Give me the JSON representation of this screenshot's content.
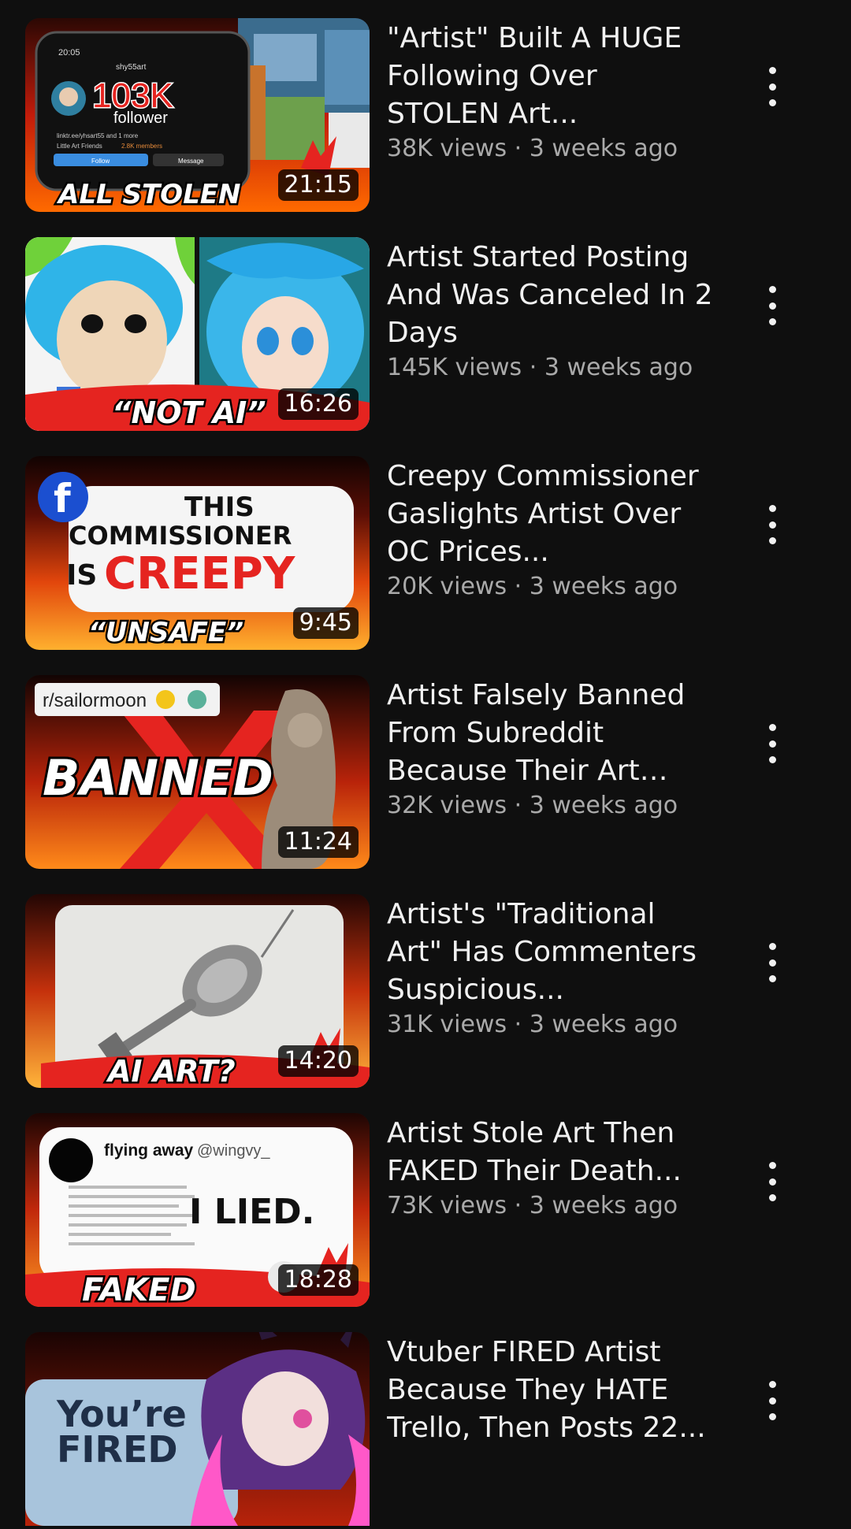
{
  "videos": [
    {
      "title": "\"Artist\" Built A HUGE Following Over STOLEN Art...",
      "views": "38K views",
      "separator": "·",
      "age": "3 weeks ago",
      "duration": "21:15",
      "thumb": {
        "icon": "phone-profile-thumbnail",
        "overlay": "ALL STOLEN",
        "profile_name": "shy55art",
        "phone_time": "20:05",
        "stat": "103K",
        "stat_label": "follower",
        "link": "linktr.ee/yhsart55 and 1 more",
        "group": "Little Art Friends",
        "members": "2.8K members",
        "follow": "Follow",
        "message": "Message"
      }
    },
    {
      "title": "Artist Started Posting And Was Canceled In 2 Days",
      "views": "145K views",
      "separator": "·",
      "age": "3 weeks ago",
      "duration": "16:26",
      "thumb": {
        "icon": "anime-girl-thumbnail",
        "overlay": "“NOT AI”"
      }
    },
    {
      "title": "Creepy Commissioner Gaslights Artist Over OC Prices...",
      "views": "20K views",
      "separator": "·",
      "age": "3 weeks ago",
      "duration": "9:45",
      "thumb": {
        "icon": "facebook-icon",
        "line1": "THIS",
        "line2": "COMMISSIONER",
        "line3a": "IS",
        "line3b": "CREEPY",
        "overlay": "“UNSAFE”"
      }
    },
    {
      "title": "Artist Falsely Banned From Subreddit Because Their Art Wa...",
      "views": "32K views",
      "separator": "·",
      "age": "3 weeks ago",
      "duration": "11:24",
      "thumb": {
        "icon": "red-x-icon",
        "subreddit": "r/sailormoon",
        "overlay": "BANNED"
      }
    },
    {
      "title": "Artist's \"Traditional Art\" Has Commenters Suspicious...",
      "views": "31K views",
      "separator": "·",
      "age": "3 weeks ago",
      "duration": "14:20",
      "thumb": {
        "icon": "ornate-key-thumbnail",
        "overlay": "AI ART?"
      }
    },
    {
      "title": "Artist Stole Art Then FAKED Their Death...",
      "views": "73K views",
      "separator": "·",
      "age": "3 weeks ago",
      "duration": "18:28",
      "thumb": {
        "icon": "tweet-thumbnail",
        "name": "flying away",
        "handle": "@wingvy_",
        "big": "I LIED.",
        "overlay": "FAKED"
      }
    },
    {
      "title": "Vtuber FIRED Artist Because They HATE Trello, Then Posts 22...",
      "views": "",
      "separator": "",
      "age": "",
      "duration": "",
      "thumb": {
        "icon": "vtuber-thumbnail",
        "line1": "You’re",
        "line2": "FIRED"
      }
    }
  ],
  "colors": {
    "background": "#0f0f0f",
    "title": "#f1f1f1",
    "meta": "#aaaaaa",
    "accent_red": "#e52420"
  }
}
